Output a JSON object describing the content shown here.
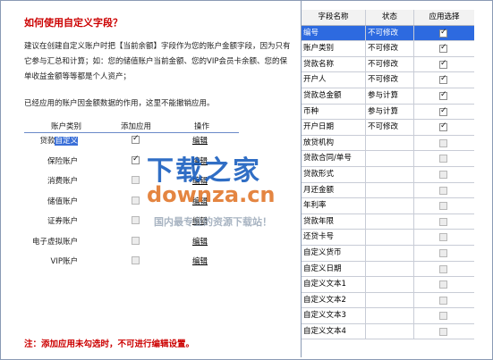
{
  "left": {
    "title": "如何使用自定义字段？",
    "desc": "建议在创建自定义账户时把【当前余额】字段作为您的账户金额字段，因为只有它参与汇总和计算；如：您的储值账户当前金额、您的VIP会员卡余额、您的保单收益金额等等都是个人资产；",
    "desc2": "已经应用的账户因金额数据的作用，这里不能撤销应用。",
    "table_headers": {
      "type": "账户类别",
      "apply": "添加应用",
      "op": "操作"
    },
    "accounts": [
      {
        "name_prefix": "贷款",
        "name_highlight": "自定义",
        "checked": true,
        "enabled": true,
        "edit": "编辑"
      },
      {
        "name_prefix": "保险账户",
        "name_highlight": "",
        "checked": true,
        "enabled": true,
        "edit": "编辑"
      },
      {
        "name_prefix": "消费账户",
        "name_highlight": "",
        "checked": false,
        "enabled": false,
        "edit": "编辑"
      },
      {
        "name_prefix": "储值账户",
        "name_highlight": "",
        "checked": false,
        "enabled": false,
        "edit": "编辑"
      },
      {
        "name_prefix": "证券账户",
        "name_highlight": "",
        "checked": false,
        "enabled": false,
        "edit": "编辑"
      },
      {
        "name_prefix": "电子虚拟账户",
        "name_highlight": "",
        "checked": false,
        "enabled": false,
        "edit": "编辑"
      },
      {
        "name_prefix": "VIP账户",
        "name_highlight": "",
        "checked": false,
        "enabled": false,
        "edit": "编辑"
      }
    ],
    "note": "注：添加应用未勾选时，不可进行编辑设置。"
  },
  "watermark": {
    "line1": "下载之家",
    "line2": "downza.cn",
    "line3": "国内最专业的资源下载站！"
  },
  "grid": {
    "headers": {
      "name": "字段名称",
      "status": "状态",
      "apply": "应用选择"
    },
    "rows": [
      {
        "name": "编号",
        "status": "不可修改",
        "checked": true,
        "selected": true
      },
      {
        "name": "账户类别",
        "status": "不可修改",
        "checked": true,
        "selected": false
      },
      {
        "name": "贷款名称",
        "status": "不可修改",
        "checked": true,
        "selected": false
      },
      {
        "name": "开户人",
        "status": "不可修改",
        "checked": true,
        "selected": false
      },
      {
        "name": "贷款总金额",
        "status": "参与计算",
        "checked": true,
        "selected": false
      },
      {
        "name": "币种",
        "status": "参与计算",
        "checked": true,
        "selected": false
      },
      {
        "name": "开户日期",
        "status": "不可修改",
        "checked": true,
        "selected": false
      },
      {
        "name": "放贷机构",
        "status": "",
        "checked": false,
        "selected": false
      },
      {
        "name": "贷款合同/单号",
        "status": "",
        "checked": false,
        "selected": false
      },
      {
        "name": "贷款形式",
        "status": "",
        "checked": false,
        "selected": false
      },
      {
        "name": "月还金额",
        "status": "",
        "checked": false,
        "selected": false
      },
      {
        "name": "年利率",
        "status": "",
        "checked": false,
        "selected": false
      },
      {
        "name": "贷款年限",
        "status": "",
        "checked": false,
        "selected": false
      },
      {
        "name": "还贷卡号",
        "status": "",
        "checked": false,
        "selected": false
      },
      {
        "name": "自定义货币",
        "status": "",
        "checked": false,
        "selected": false
      },
      {
        "name": "自定义日期",
        "status": "",
        "checked": false,
        "selected": false
      },
      {
        "name": "自定义文本1",
        "status": "",
        "checked": false,
        "selected": false
      },
      {
        "name": "自定义文本2",
        "status": "",
        "checked": false,
        "selected": false
      },
      {
        "name": "自定义文本3",
        "status": "",
        "checked": false,
        "selected": false
      },
      {
        "name": "自定义文本4",
        "status": "",
        "checked": false,
        "selected": false
      }
    ]
  }
}
